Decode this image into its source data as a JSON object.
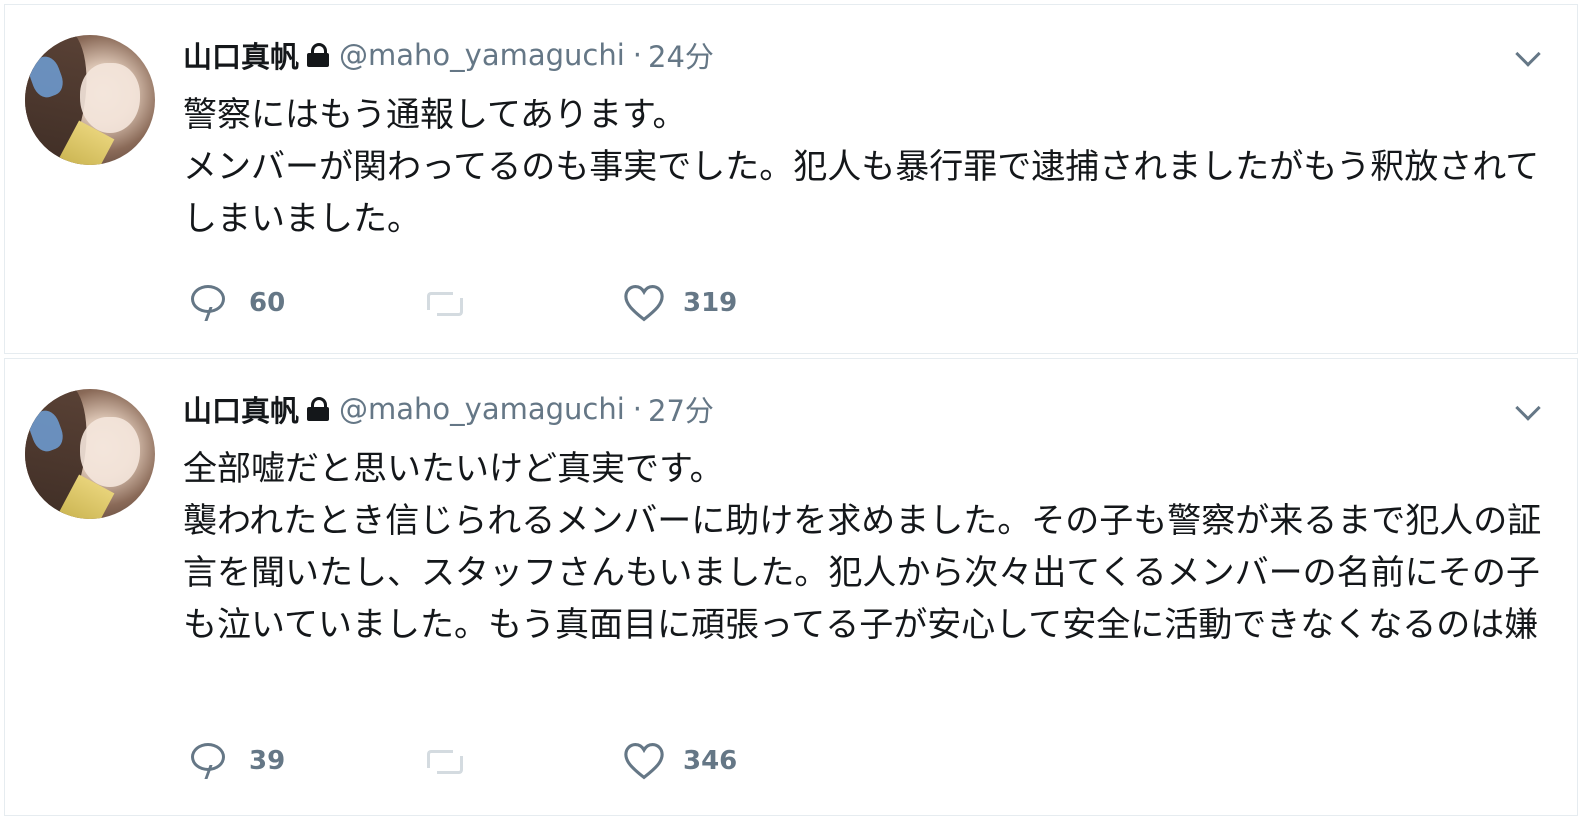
{
  "tweets": [
    {
      "author_name": "山口真帆",
      "handle": "@maho_yamaguchi",
      "separator": "·",
      "time": "24分",
      "text": "警察にはもう通報してあります。\nメンバーが関わってるのも事実でした。犯人も暴行罪で逮捕されましたがもう釈放されてしまいました。",
      "reply_count": "60",
      "like_count": "319"
    },
    {
      "author_name": "山口真帆",
      "handle": "@maho_yamaguchi",
      "separator": "·",
      "time": "27分",
      "text": "全部嘘だと思いたいけど真実です。\n襲われたとき信じられるメンバーに助けを求めました。その子も警察が来るまで犯人の証言を聞いたし、スタッフさんもいました。犯人から次々出てくるメンバーの名前にその子も泣いていました。もう真面目に頑張ってる子が安心して安全に活動できなくなるのは嫌",
      "reply_count": "39",
      "like_count": "346"
    }
  ],
  "icons": {
    "lock": "lock-icon",
    "menu": "chevron-down-icon",
    "reply": "reply-icon",
    "retweet": "retweet-icon",
    "like": "like-icon"
  },
  "colors": {
    "text": "#14171a",
    "secondary": "#657786",
    "divider": "#e6ecf0",
    "retweet_disabled": "#aab8c2"
  }
}
